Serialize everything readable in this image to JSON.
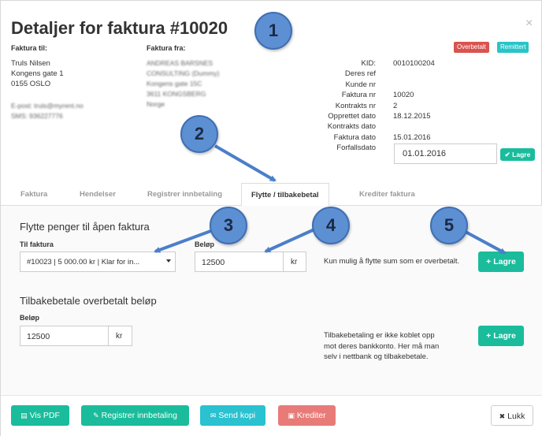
{
  "modal": {
    "title": "Detaljer for faktura #10020",
    "close_label": "×",
    "badges": [
      "Overbetalt",
      "Remittert"
    ]
  },
  "billing": {
    "to_label": "Faktura til:",
    "to_lines": [
      "Truls Nilsen",
      "Kongens gate 1",
      "0155 OSLO"
    ],
    "to_contact": [
      "E-post: truls@myrent.no",
      "SMS: 936227776"
    ],
    "from_label": "Faktura fra:",
    "from_lines": [
      "ANDREAS BARSNES",
      "CONSULTING (Dummy)",
      "Kongens gate 15C",
      "3611 KONGSBERG",
      "Norge"
    ]
  },
  "details": {
    "keys": [
      "KID:",
      "Deres ref",
      "Kunde nr",
      "Faktura nr",
      "Kontrakts nr",
      "Opprettet dato",
      "Kontrakts dato",
      "Faktura dato",
      "Forfallsdato"
    ],
    "values": [
      "0010100204",
      "",
      "",
      "10020",
      "2",
      "18.12.2015",
      "",
      "15.01.2016"
    ],
    "due_date_value": "01.01.2016",
    "save_small_label": "✔ Lagre"
  },
  "tabs": [
    "Faktura",
    "Hendelser",
    "Registrer innbetaling",
    "Flytte / tilbakebetal",
    "Krediter faktura"
  ],
  "move": {
    "section_title": "Flytte penger til åpen faktura",
    "to_invoice_label": "Til faktura",
    "to_invoice_value": "#10023 | 5 000.00 kr | Klar for in...",
    "amount_label": "Beløp",
    "amount_value": "12500",
    "currency": "kr",
    "note": "Kun mulig å flytte sum som er overbetalt.",
    "save_label": "+ Lagre"
  },
  "refund": {
    "section_title": "Tilbakebetale overbetalt beløp",
    "amount_label": "Beløp",
    "amount_value": "12500",
    "currency": "kr",
    "note": "Tilbakebetaling er ikke koblet opp mot deres bankkonto. Her må man selv i nettbank og tilbakebetale.",
    "save_label": "+ Lagre"
  },
  "footer": {
    "pdf_label": "Vis PDF",
    "register_label": "Registrer innbetaling",
    "send_copy_label": "Send kopi",
    "credit_label": "Krediter",
    "close_label": "Lukk"
  },
  "callouts": [
    "1",
    "2",
    "3",
    "4",
    "5"
  ],
  "colors": {
    "green": "#1abc9c",
    "cyan": "#2ac1d0",
    "salmon": "#e87b78",
    "red_badge": "#d9534f",
    "teal_badge": "#29c4c8",
    "callout_blue": "#5d8fd3"
  }
}
